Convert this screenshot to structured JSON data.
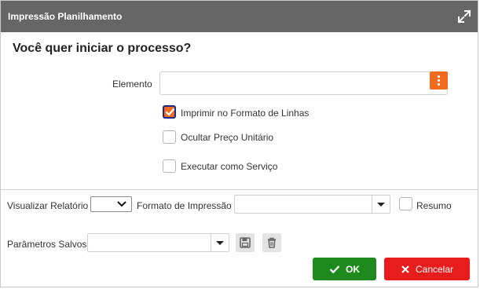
{
  "window": {
    "title": "Impressão Planilhamento"
  },
  "dialog": {
    "question": "Você quer iniciar o processo?"
  },
  "form": {
    "elemento_label": "Elemento",
    "elemento_value": "",
    "checkboxes": [
      {
        "label": "Imprimir no Formato de Linhas",
        "checked": true
      },
      {
        "label": "Ocultar Preço Unitário",
        "checked": false
      },
      {
        "label": "Executar como Serviço",
        "checked": false
      }
    ]
  },
  "footer": {
    "visualizar_label": "Visualizar Relatório",
    "visualizar_value": "",
    "formato_label": "Formato de Impressão",
    "formato_value": "",
    "resumo_label": "Resumo",
    "resumo_checked": false,
    "parametros_label": "Parâmetros Salvos",
    "parametros_value": ""
  },
  "buttons": {
    "ok_label": "OK",
    "cancel_label": "Cancelar"
  },
  "icons": {
    "expand": "expand-icon",
    "menu": "kebab-menu-icon",
    "save": "floppy-disk-icon",
    "delete": "trash-icon",
    "ok": "check-icon",
    "cancel": "x-icon"
  },
  "colors": {
    "titlebar": "#666666",
    "accent_orange": "#f26b1d",
    "ok_green": "#1e8a1e",
    "cancel_red": "#e81c1c"
  }
}
